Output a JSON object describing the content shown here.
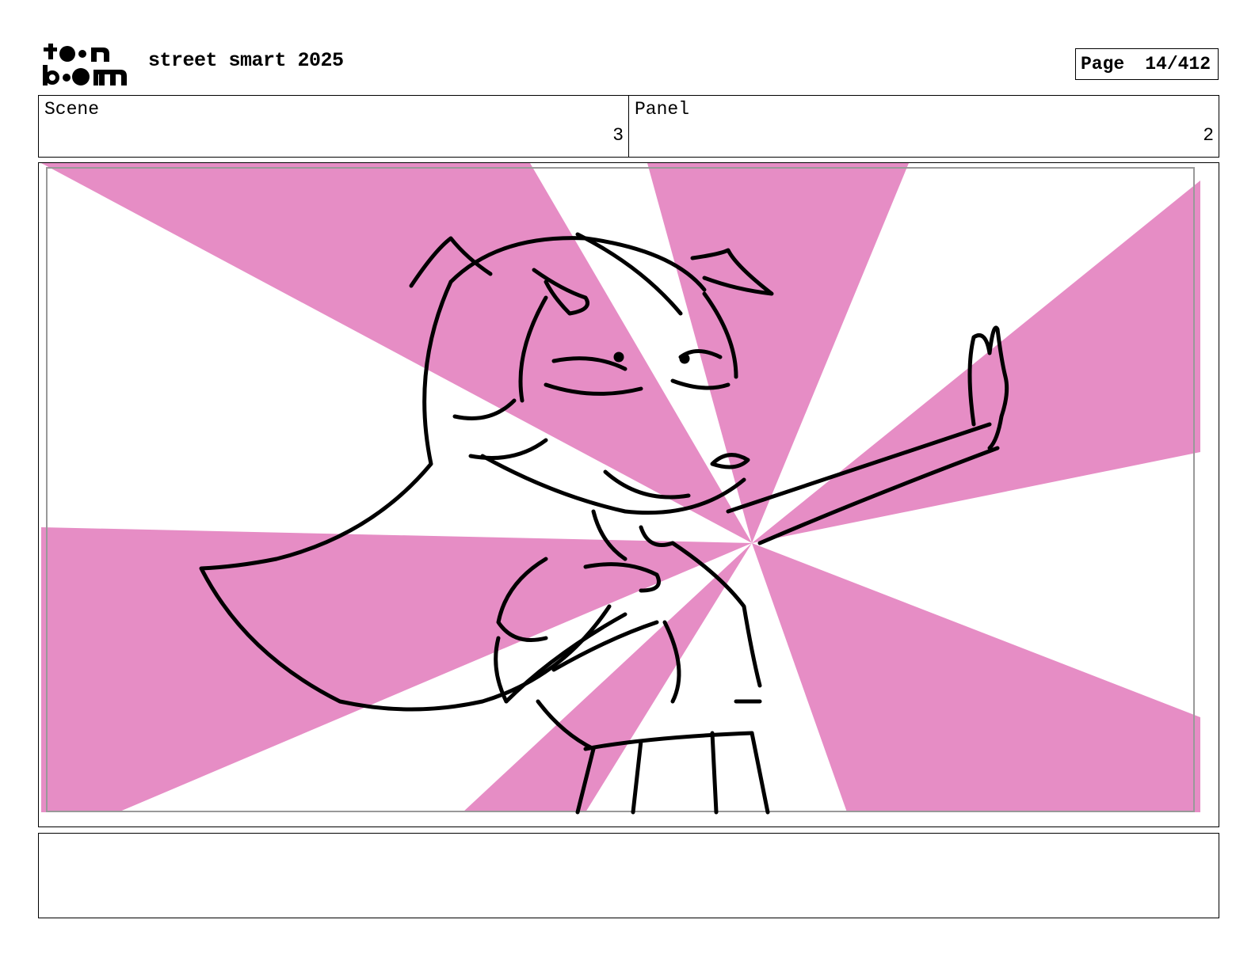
{
  "header": {
    "logo_text": "toon boom",
    "project_title": "street smart 2025",
    "page_label": "Page",
    "page_number": "14/412"
  },
  "info": {
    "scene_label": "Scene",
    "scene_value": "3",
    "panel_label": "Panel",
    "panel_value": "2"
  },
  "panel": {
    "background_color": "#e68dc5",
    "line_color": "#000000",
    "notes_text": ""
  }
}
